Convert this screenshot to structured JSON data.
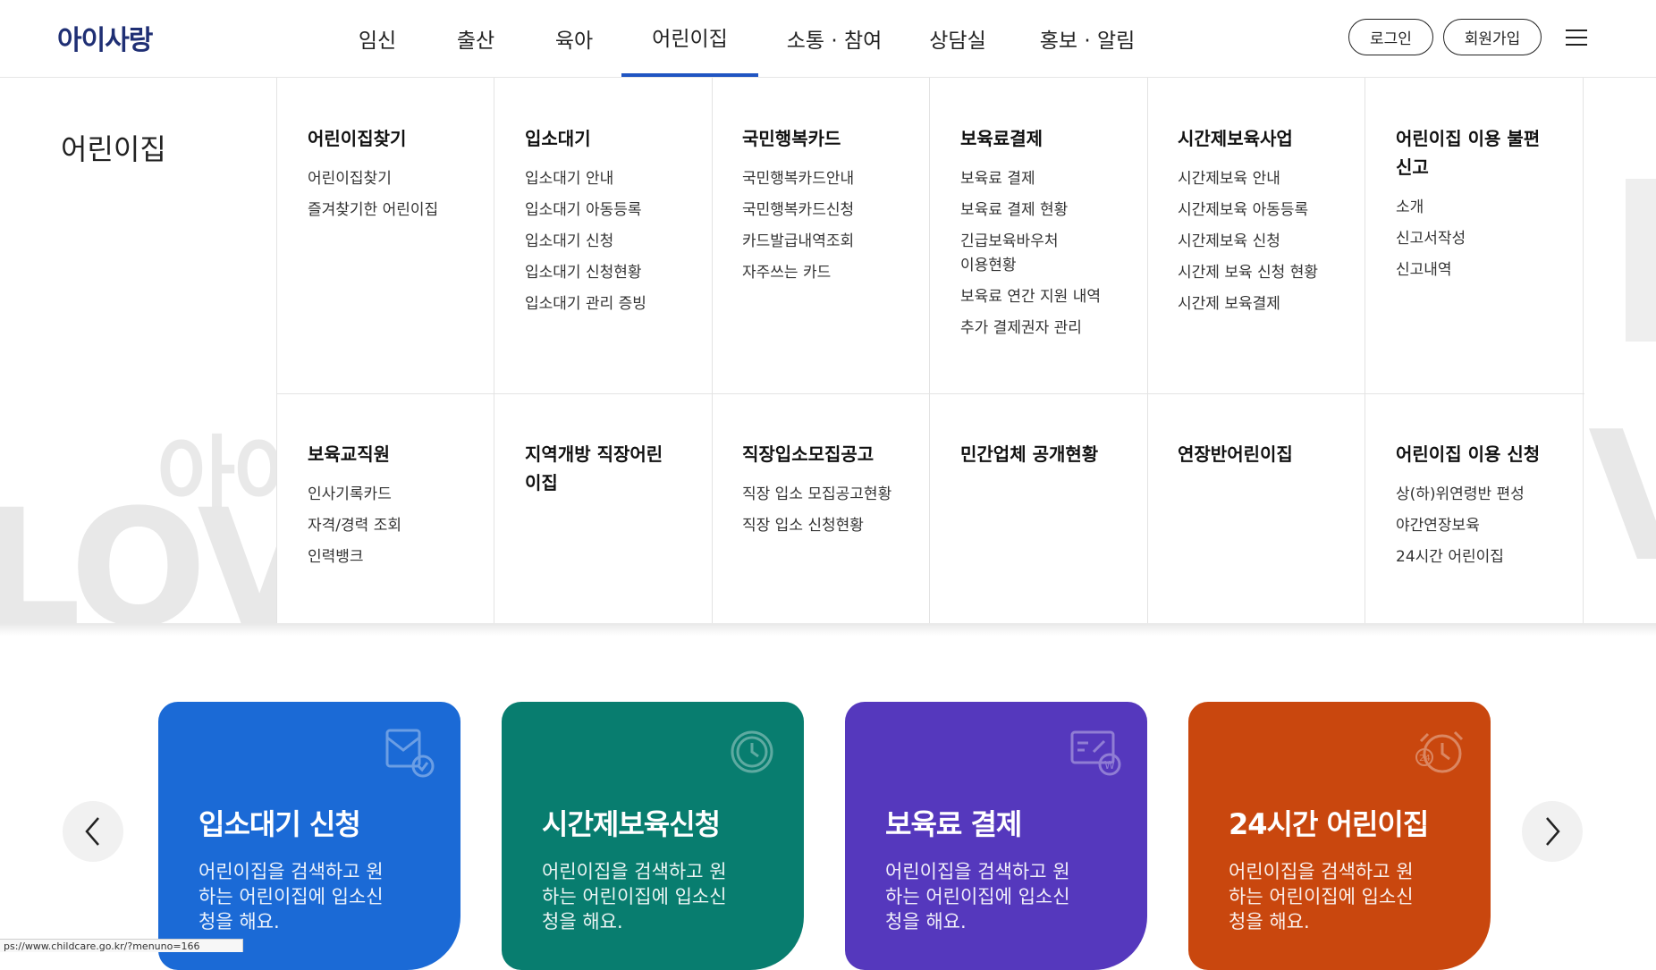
{
  "header": {
    "logo": "아이사랑",
    "nav": [
      "임신",
      "출산",
      "육아",
      "어린이집",
      "소통 · 참여",
      "상담실",
      "홍보 · 알림"
    ],
    "login": "로그인",
    "signup": "회원가입"
  },
  "background": {
    "text1": "아이",
    "text2": "LOVE",
    "text3": "V"
  },
  "mega": {
    "title": "어린이집",
    "columns": [
      {
        "head": "어린이집찾기",
        "items": [
          "어린이집찾기",
          "즐겨찾기한 어린이집"
        ]
      },
      {
        "head": "입소대기",
        "items": [
          "입소대기 안내",
          "입소대기 아동등록",
          "입소대기 신청",
          "입소대기 신청현황",
          "입소대기 관리 증빙"
        ]
      },
      {
        "head": "국민행복카드",
        "items": [
          "국민행복카드안내",
          "국민행복카드신청",
          "카드발급내역조회",
          "자주쓰는 카드"
        ]
      },
      {
        "head": "보육료결제",
        "items": [
          "보육료 결제",
          "보육료 결제 현황",
          "긴급보육바우처 이용현황",
          "보육료 연간 지원 내역",
          "추가 결제권자 관리"
        ]
      },
      {
        "head": "시간제보육사업",
        "items": [
          "시간제보육 안내",
          "시간제보육 아동등록",
          "시간제보육 신청",
          "시간제 보육 신청 현황",
          "시간제 보육결제"
        ]
      },
      {
        "head": "어린이집 이용 불편신고",
        "items": [
          "소개",
          "신고서작성",
          "신고내역"
        ]
      },
      {
        "head": "보육교직원",
        "items": [
          "인사기록카드",
          "자격/경력 조회",
          "인력뱅크"
        ]
      },
      {
        "head": "지역개방 직장어린이집",
        "items": []
      },
      {
        "head": "직장입소모집공고",
        "items": [
          "직장 입소 모집공고현황",
          "직장 입소 신청현황"
        ]
      },
      {
        "head": "민간업체 공개현황",
        "items": []
      },
      {
        "head": "연장반어린이집",
        "items": []
      },
      {
        "head": "어린이집 이용 신청",
        "items": [
          "상(하)위연령반 편성",
          "야간연장보육",
          "24시간 어린이집"
        ]
      }
    ]
  },
  "cards": [
    {
      "title": "입소대기 신청",
      "desc": "어린이집을 검색하고 원하는 어린이집에 입소신청을 해요.",
      "color": "#1b6ad6",
      "icon": "application-form-icon"
    },
    {
      "title": "시간제보육신청",
      "desc": "어린이집을 검색하고 원하는 어린이집에 입소신청을 해요.",
      "color": "#087d6f",
      "icon": "alarm-clock-icon"
    },
    {
      "title": "보육료 결제",
      "desc": "어린이집을 검색하고 원하는 어린이집에 입소신청을 해요.",
      "color": "#5538bd",
      "icon": "payment-card-icon"
    },
    {
      "title": "24시간 어린이집",
      "desc": "어린이집을 검색하고 원하는 어린이집에 입소신청을 해요.",
      "color": "#c9470e",
      "icon": "24h-clock-icon"
    }
  ],
  "status_url": "ps://www.childcare.go.kr/?menuno=166"
}
